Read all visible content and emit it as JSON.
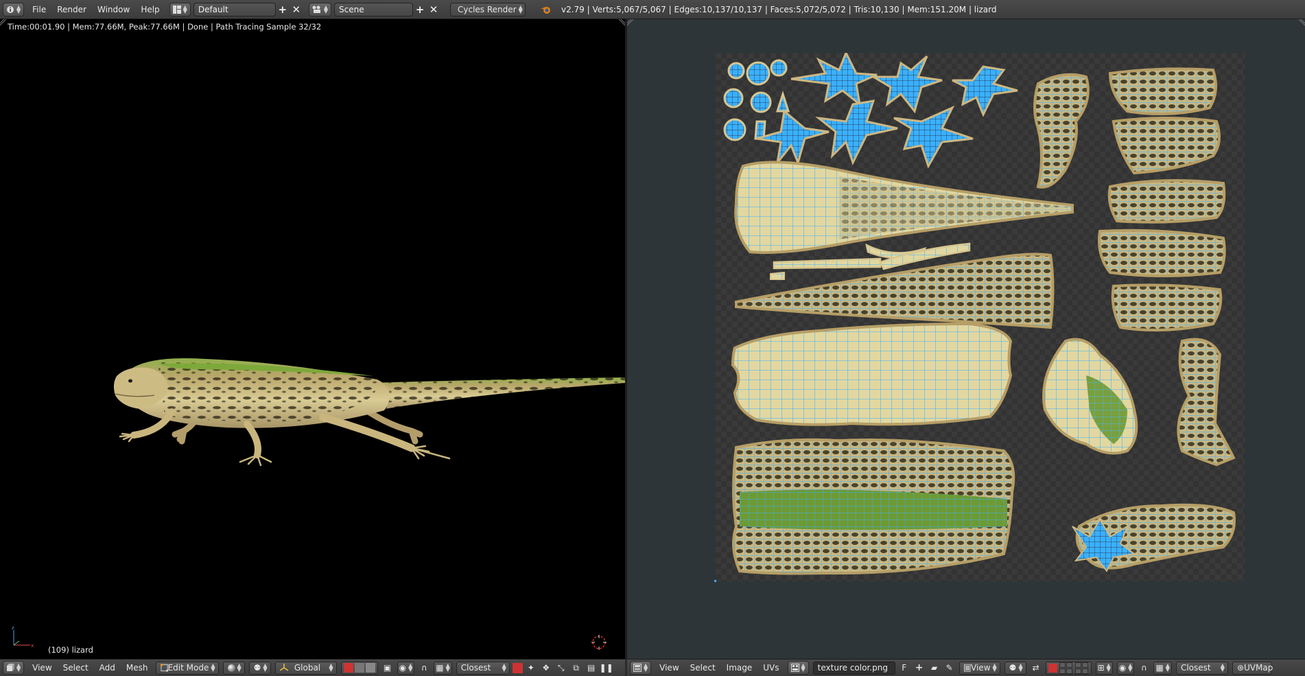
{
  "top_header": {
    "menus": [
      "File",
      "Render",
      "Window",
      "Help"
    ],
    "screen_layout": "Default",
    "scene": "Scene",
    "render_engine": "Cycles Render",
    "stats": "v2.79 | Verts:5,067/5,067 | Edges:10,137/10,137 | Faces:5,072/5,072 | Tris:10,130 | Mem:151.20M | lizard"
  },
  "viewport": {
    "render_info": "Time:00:01.90 | Mem:77.66M, Peak:77.66M | Done | Path Tracing Sample 32/32",
    "object_info": "(109) lizard"
  },
  "bottom_left": {
    "menus": [
      "View",
      "Select",
      "Add",
      "Mesh"
    ],
    "mode": "Edit Mode",
    "orientation": "Global",
    "snap_target": "Closest"
  },
  "bottom_right": {
    "menus": [
      "View",
      "Select",
      "Image",
      "UVs"
    ],
    "image_name": "texture color.png",
    "image_fake_user": "F",
    "view_menu": "View",
    "snap_target": "Closest",
    "uv_map": "UVMap"
  },
  "colors": {
    "uv_edge": "#3ab0ff",
    "lizard_skin": "#d8c98c",
    "lizard_green": "#7da83a"
  }
}
